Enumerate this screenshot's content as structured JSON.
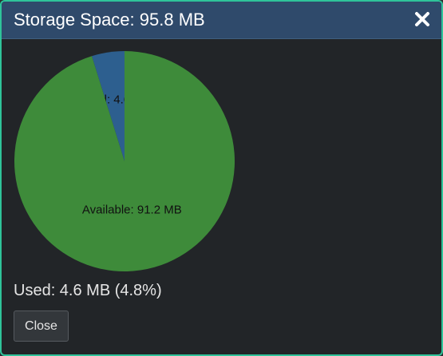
{
  "dialog": {
    "title": "Storage Space: 95.8 MB",
    "close_icon": "close-icon",
    "used_summary": "Used: 4.6 MB (4.8%)",
    "close_label": "Close"
  },
  "colors": {
    "accent_border": "#2fc49a",
    "titlebar": "#2f4a6b",
    "used_slice": "#2d5f8f",
    "available_slice": "#3e8b3a"
  },
  "chart_data": {
    "type": "pie",
    "slices": [
      {
        "name": "Used",
        "value": 4.6,
        "label": "Used: 4.6 MB"
      },
      {
        "name": "Available",
        "value": 91.2,
        "label": "Available: 91.2 MB"
      }
    ],
    "total": 95.8,
    "unit": "MB"
  }
}
